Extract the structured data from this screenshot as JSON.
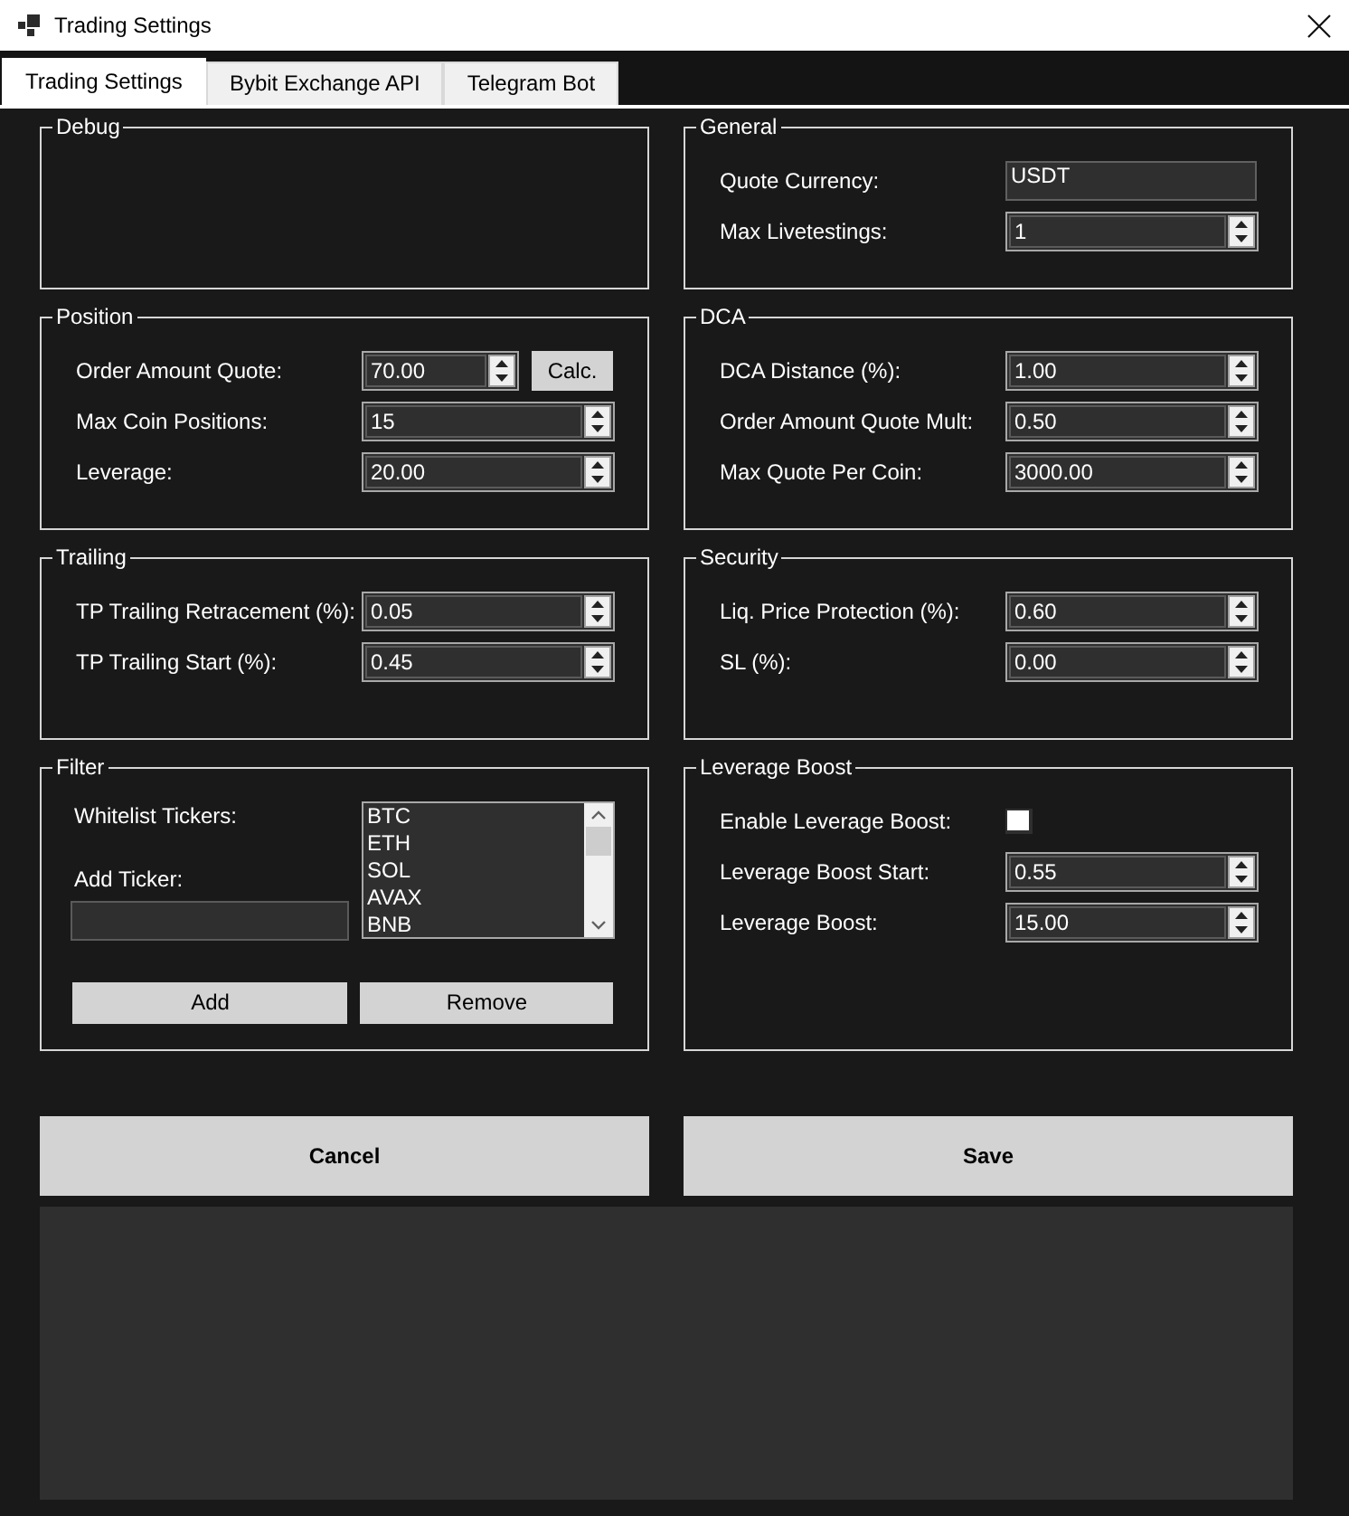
{
  "window": {
    "title": "Trading Settings"
  },
  "tabs": [
    {
      "label": "Trading Settings",
      "selected": true
    },
    {
      "label": "Bybit Exchange API",
      "selected": false
    },
    {
      "label": "Telegram Bot",
      "selected": false
    }
  ],
  "groups": [
    {
      "title": "Debug"
    },
    {
      "title": "General",
      "fields": [
        {
          "kind": "text",
          "label": "Quote Currency:",
          "value": "USDT"
        },
        {
          "kind": "spin",
          "label": "Max Livetestings:",
          "value": "1"
        }
      ]
    },
    {
      "title": "Position",
      "fields": [
        {
          "kind": "spin",
          "label": "Order Amount Quote:",
          "value": "70.00",
          "button": "Calc."
        },
        {
          "kind": "spin",
          "label": "Max Coin Positions:",
          "value": "15"
        },
        {
          "kind": "spin",
          "label": "Leverage:",
          "value": "20.00"
        }
      ]
    },
    {
      "title": "DCA",
      "fields": [
        {
          "kind": "spin",
          "label": "DCA Distance (%):",
          "value": "1.00"
        },
        {
          "kind": "spin",
          "label": "Order Amount Quote Mult:",
          "value": "0.50"
        },
        {
          "kind": "spin",
          "label": "Max Quote Per Coin:",
          "value": "3000.00"
        }
      ]
    },
    {
      "title": "Trailing",
      "fields": [
        {
          "kind": "spin",
          "label": "TP Trailing Retracement (%):",
          "value": "0.05"
        },
        {
          "kind": "spin",
          "label": "TP Trailing Start (%):",
          "value": "0.45"
        }
      ]
    },
    {
      "title": "Security",
      "fields": [
        {
          "kind": "spin",
          "label": "Liq. Price Protection (%):",
          "value": "0.60"
        },
        {
          "kind": "spin",
          "label": "SL (%):",
          "value": "0.00"
        }
      ]
    },
    {
      "title": "Filter",
      "fields": [
        {
          "kind": "list",
          "label": "Whitelist Tickers:",
          "items": [
            "BTC",
            "ETH",
            "SOL",
            "AVAX",
            "BNB"
          ]
        },
        {
          "kind": "input",
          "label": "Add Ticker:"
        }
      ],
      "buttons": [
        "Add",
        "Remove"
      ]
    },
    {
      "title": "Leverage Boost",
      "fields": [
        {
          "kind": "checkbox",
          "label": "Enable Leverage Boost:",
          "checked": false
        },
        {
          "kind": "spin",
          "label": "Leverage Boost Start:",
          "value": "0.55"
        },
        {
          "kind": "spin",
          "label": "Leverage Boost:",
          "value": "15.00"
        }
      ]
    }
  ],
  "actions": [
    "Cancel",
    "Save"
  ]
}
